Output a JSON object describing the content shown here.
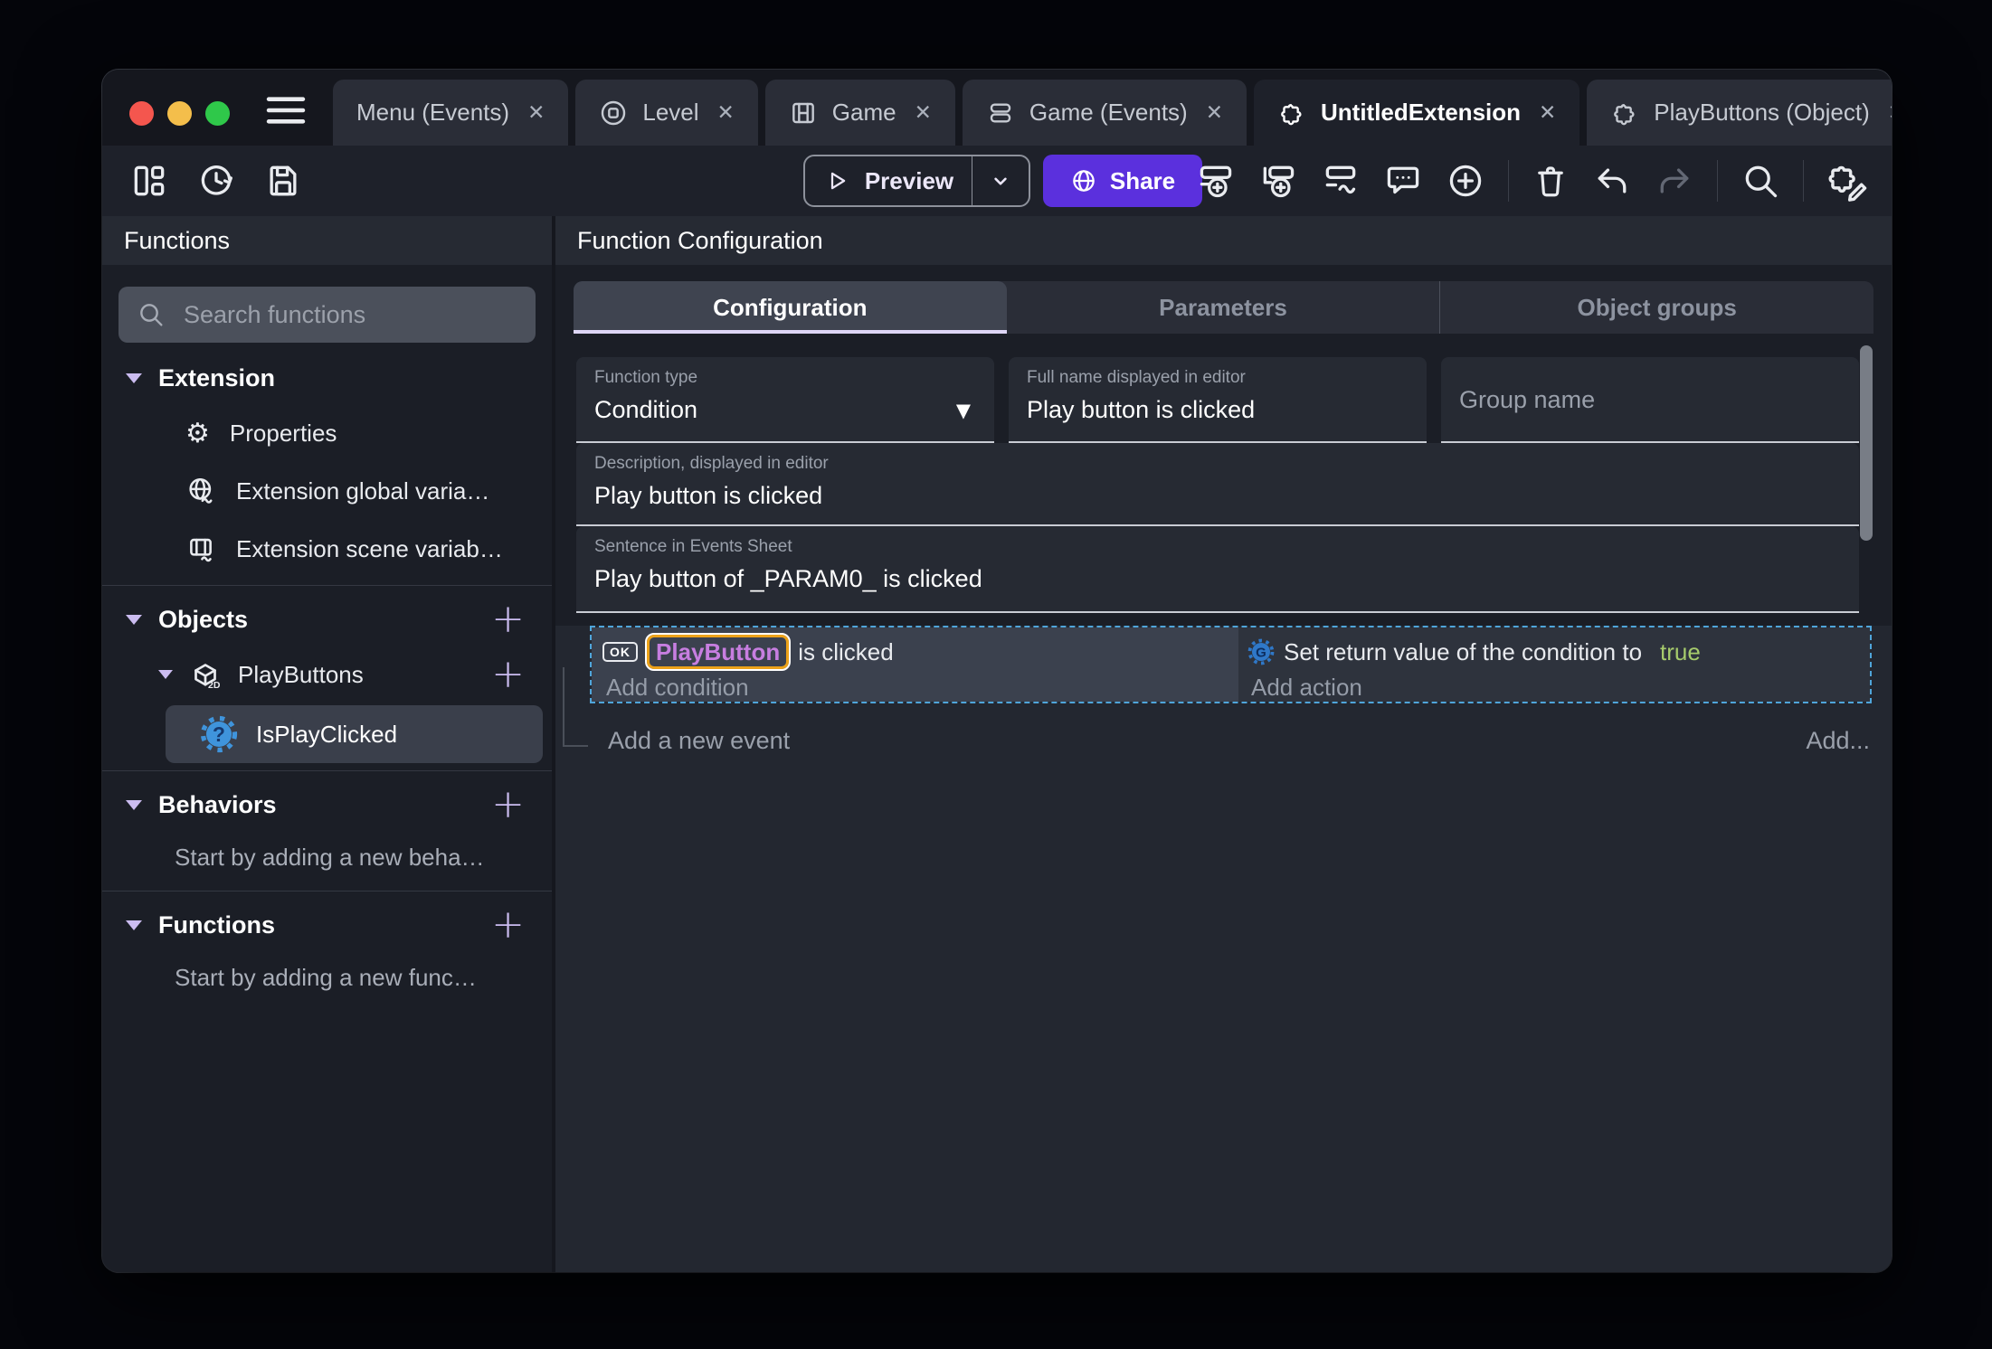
{
  "colors": {
    "accent_purple": "#5b30dd",
    "selection_orange": "#eca219",
    "object_name_purple": "#c77ee0",
    "true_green": "#a6cb6c",
    "event_selection_blue": "#4fa5da",
    "tab_underline_lavender": "#ded6f6"
  },
  "tabs": [
    {
      "label": "Menu (Events)",
      "icon": null
    },
    {
      "label": "Level",
      "icon": "level-icon"
    },
    {
      "label": "Game",
      "icon": "film-icon"
    },
    {
      "label": "Game (Events)",
      "icon": "events-list-icon"
    },
    {
      "label": "UntitledExtension",
      "icon": "puzzle-icon"
    },
    {
      "label": "PlayButtons (Object)",
      "icon": "puzzle-icon"
    }
  ],
  "toolbar": {
    "preview_label": "Preview",
    "share_label": "Share",
    "icons": [
      "project-manager-icon",
      "history-icon",
      "save-icon",
      "add-event-icon",
      "add-subevent-icon",
      "add-other-event-icon",
      "comment-icon",
      "add-circle-icon",
      "trash-icon",
      "undo-icon",
      "redo-icon",
      "search-icon",
      "edit-extension-icon"
    ]
  },
  "sidebar": {
    "title": "Functions",
    "search_placeholder": "Search functions",
    "extension_section": {
      "title": "Extension",
      "items": [
        {
          "label": "Properties",
          "icon": "gear-icon"
        },
        {
          "label": "Extension global varia…",
          "icon": "globe-variables-icon"
        },
        {
          "label": "Extension scene variab…",
          "icon": "scene-variables-icon"
        }
      ]
    },
    "objects_section": {
      "title": "Objects",
      "object": {
        "label": "PlayButtons",
        "icon": "cube-2d-icon"
      },
      "function": {
        "label": "IsPlayClicked",
        "icon": "function-gear-icon"
      }
    },
    "behaviors_section": {
      "title": "Behaviors",
      "helper": "Start by adding a new beha…"
    },
    "functions_section": {
      "title": "Functions",
      "helper": "Start by adding a new func…"
    }
  },
  "main": {
    "title": "Function Configuration",
    "tabs": [
      {
        "label": "Configuration",
        "active": true
      },
      {
        "label": "Parameters",
        "active": false
      },
      {
        "label": "Object groups",
        "active": false
      }
    ],
    "fields": {
      "function_type": {
        "label": "Function type",
        "value": "Condition"
      },
      "full_name": {
        "label": "Full name displayed in editor",
        "value": "Play button is clicked"
      },
      "group_name": {
        "placeholder": "Group name"
      },
      "description": {
        "label": "Description, displayed in editor",
        "value": "Play button is clicked"
      },
      "sentence": {
        "label": "Sentence in Events Sheet",
        "value": "Play button of _PARAM0_ is clicked"
      }
    },
    "events": {
      "condition": {
        "badge": "OK",
        "object_name": "PlayButton",
        "suffix": "is clicked",
        "add_label": "Add condition"
      },
      "action": {
        "text": "Set return value of the condition to",
        "value": "true",
        "add_label": "Add action"
      },
      "add_event_label": "Add a new event",
      "add_more_label": "Add..."
    }
  }
}
